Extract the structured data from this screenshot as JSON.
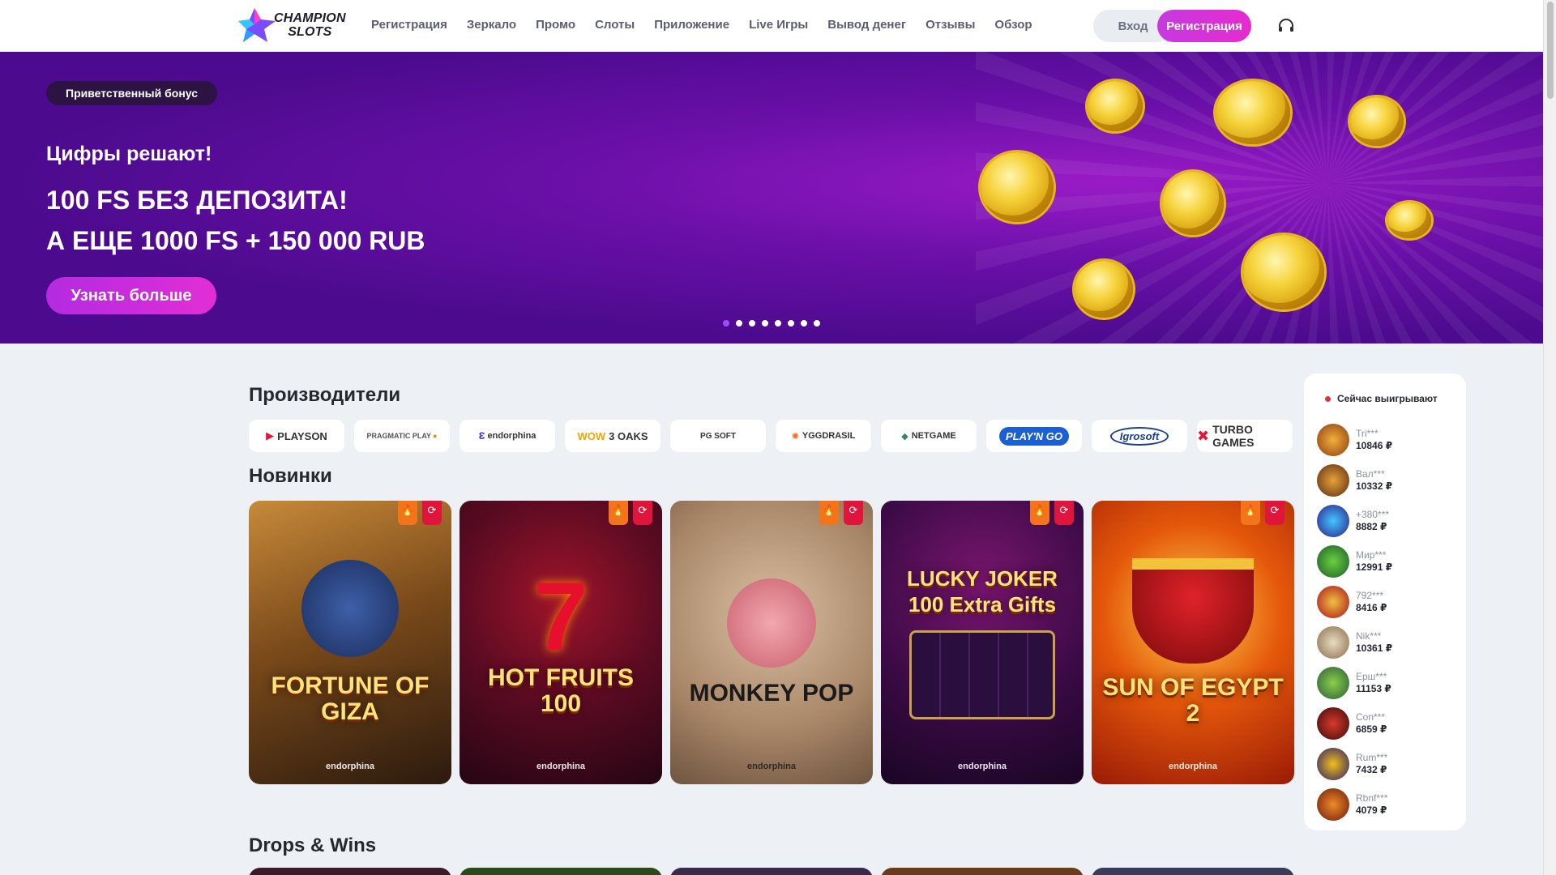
{
  "header": {
    "logo_line1": "CHAMPION",
    "logo_line2": "SLOTS",
    "nav": [
      "Регистрация",
      "Зеркало",
      "Промо",
      "Слоты",
      "Приложение",
      "Live Игры",
      "Вывод денег",
      "Отзывы",
      "Обзор"
    ],
    "login_label": "Вход",
    "register_label": "Регистрация",
    "support_icon": "headset-icon"
  },
  "hero": {
    "badge": "Приветственный бонус",
    "subtitle": "Цифры решают!",
    "title_line1": "100 FS БЕЗ ДЕПОЗИТА!",
    "title_line2": "А ЕЩЕ 1000 FS + 150 000 RUB",
    "cta": "Узнать больше",
    "slides_total": 8,
    "active_slide": 1
  },
  "providers": {
    "title": "Производители",
    "items": [
      "PLAYSON",
      "PRAGMATIC PLAY",
      "endorphina",
      "3 OAKS",
      "PG SOFT",
      "YGGDRASIL",
      "NETGAME",
      "PLAY'N GO",
      "Igrosoft",
      "TURBO GAMES"
    ]
  },
  "new_games": {
    "title": "Новинки",
    "items": [
      {
        "title": "FORTUNE OF GIZA",
        "provider": "endorphina"
      },
      {
        "title": "HOT FRUITS 100",
        "provider": "endorphina"
      },
      {
        "title": "MONKEY POP",
        "provider": "endorphina"
      },
      {
        "title": "LUCKY JOKER 100 Extra Gifts",
        "provider": "endorphina"
      },
      {
        "title": "SUN OF EGYPT 2",
        "provider": "endorphina"
      }
    ]
  },
  "drops": {
    "title": "Drops & Wins"
  },
  "winners": {
    "title": "Сейчас выигрывают",
    "items": [
      {
        "name": "Tri***",
        "amount": "10846 ₽"
      },
      {
        "name": "Вал***",
        "amount": "10332 ₽"
      },
      {
        "name": "+380***",
        "amount": "8882 ₽"
      },
      {
        "name": "Мир***",
        "amount": "12991 ₽"
      },
      {
        "name": "792***",
        "amount": "8416 ₽"
      },
      {
        "name": "Nik***",
        "amount": "10361 ₽"
      },
      {
        "name": "Ерш***",
        "amount": "11153 ₽"
      },
      {
        "name": "Con***",
        "amount": "6859 ₽"
      },
      {
        "name": "Rum***",
        "amount": "7432 ₽"
      },
      {
        "name": "Rbnf***",
        "amount": "4079 ₽"
      }
    ]
  },
  "colors": {
    "accent": "#d633dc",
    "hero_bg": "#5a0d9c"
  }
}
